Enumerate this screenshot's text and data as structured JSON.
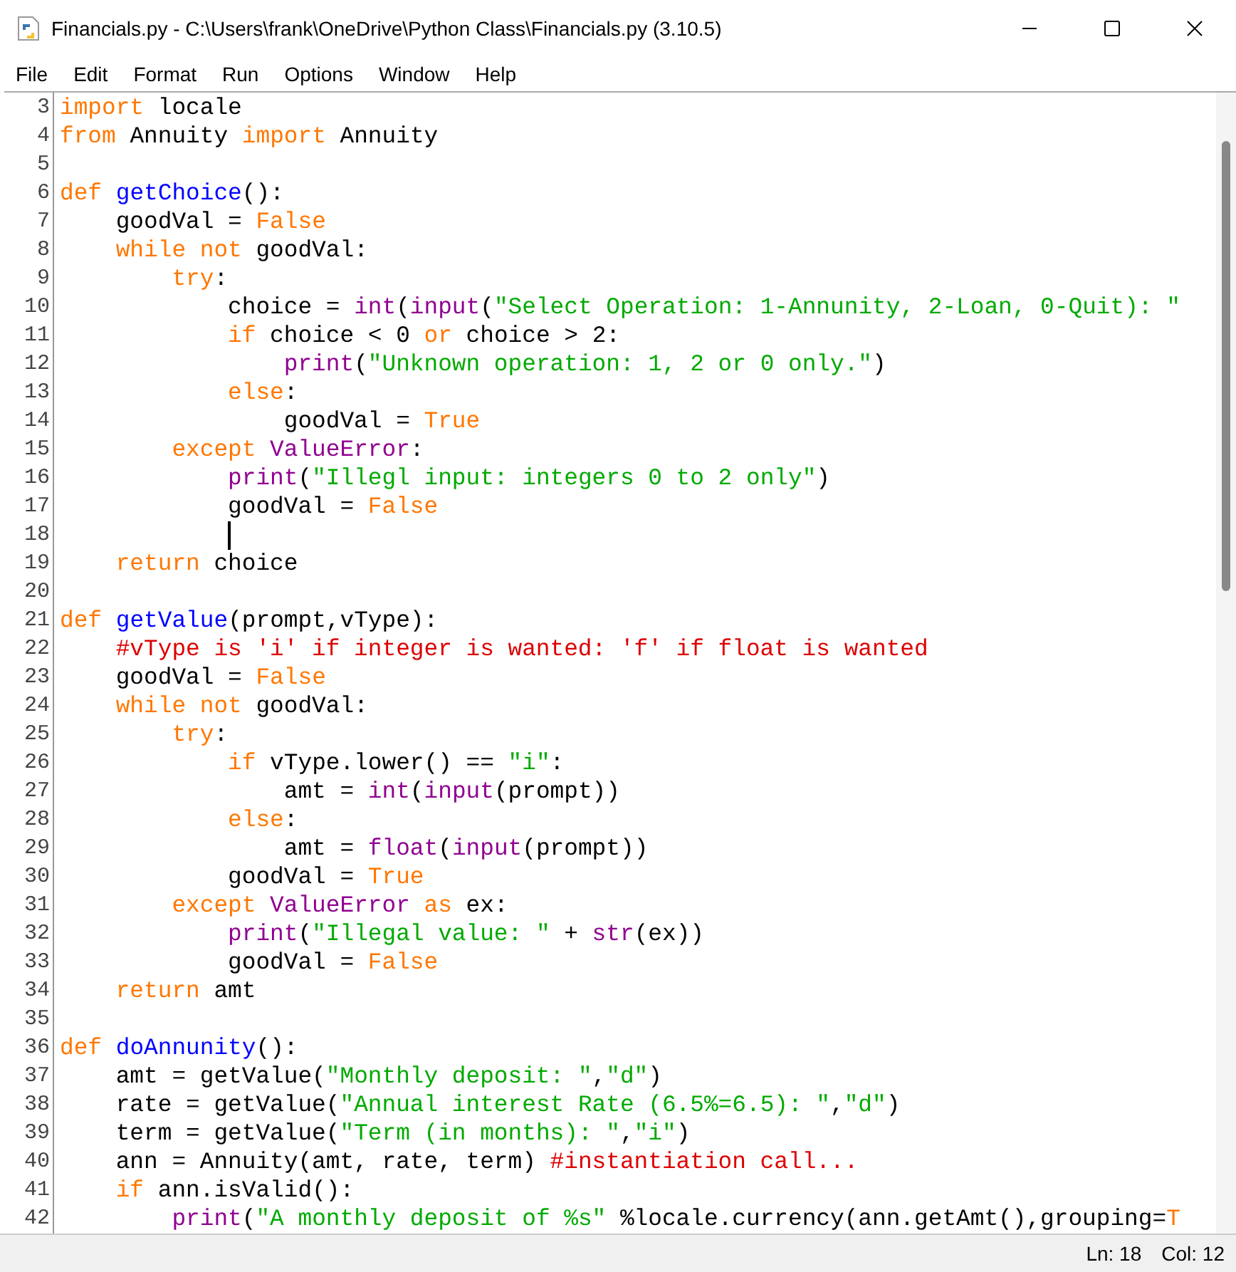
{
  "window": {
    "title": "Financials.py - C:\\Users\\frank\\OneDrive\\Python Class\\Financials.py (3.10.5)"
  },
  "menu": [
    {
      "label": "File"
    },
    {
      "label": "Edit"
    },
    {
      "label": "Format"
    },
    {
      "label": "Run"
    },
    {
      "label": "Options"
    },
    {
      "label": "Window"
    },
    {
      "label": "Help"
    }
  ],
  "editor": {
    "lines": [
      {
        "number": "3",
        "cursor": false,
        "tokens": [
          {
            "kind": "keyword",
            "text": "import"
          },
          {
            "kind": "plain",
            "text": " locale"
          }
        ]
      },
      {
        "number": "4",
        "cursor": false,
        "tokens": [
          {
            "kind": "keyword",
            "text": "from"
          },
          {
            "kind": "plain",
            "text": " Annuity "
          },
          {
            "kind": "keyword",
            "text": "import"
          },
          {
            "kind": "plain",
            "text": " Annuity"
          }
        ]
      },
      {
        "number": "5",
        "cursor": false
      },
      {
        "number": "6",
        "cursor": false,
        "tokens": [
          {
            "kind": "keyword",
            "text": "def "
          },
          {
            "kind": "definition",
            "text": "getChoice"
          },
          {
            "kind": "plain",
            "text": "():"
          }
        ],
        "children": [
          {
            "number": "7",
            "cursor": false,
            "tokens": [
              {
                "kind": "plain",
                "text": "goodVal = "
              },
              {
                "kind": "keyword",
                "text": "False"
              }
            ]
          },
          {
            "number": "8",
            "cursor": false,
            "tokens": [
              {
                "kind": "keyword",
                "text": "while not"
              },
              {
                "kind": "plain",
                "text": " goodVal:"
              }
            ],
            "children": [
              {
                "number": "9",
                "cursor": false,
                "tokens": [
                  {
                    "kind": "keyword",
                    "text": "try"
                  },
                  {
                    "kind": "plain",
                    "text": ":"
                  }
                ],
                "children": [
                  {
                    "number": "10",
                    "cursor": false,
                    "tokens": [
                      {
                        "kind": "plain",
                        "text": "choice = "
                      },
                      {
                        "kind": "builtin",
                        "text": "int"
                      },
                      {
                        "kind": "plain",
                        "text": "("
                      },
                      {
                        "kind": "builtin",
                        "text": "input"
                      },
                      {
                        "kind": "plain",
                        "text": "("
                      },
                      {
                        "kind": "string",
                        "text": "\"Select Operation: 1-Annunity, 2-Loan, 0-Quit): \""
                      }
                    ]
                  },
                  {
                    "number": "11",
                    "cursor": false,
                    "tokens": [
                      {
                        "kind": "keyword",
                        "text": "if"
                      },
                      {
                        "kind": "plain",
                        "text": " choice < 0 "
                      },
                      {
                        "kind": "keyword",
                        "text": "or"
                      },
                      {
                        "kind": "plain",
                        "text": " choice > 2:"
                      }
                    ],
                    "children": [
                      {
                        "number": "12",
                        "cursor": false,
                        "tokens": [
                          {
                            "kind": "builtin",
                            "text": "print"
                          },
                          {
                            "kind": "plain",
                            "text": "("
                          },
                          {
                            "kind": "string",
                            "text": "\"Unknown operation: 1, 2 or 0 only.\""
                          },
                          {
                            "kind": "plain",
                            "text": ")"
                          }
                        ]
                      }
                    ]
                  },
                  {
                    "number": "13",
                    "cursor": false,
                    "tokens": [
                      {
                        "kind": "keyword",
                        "text": "else"
                      },
                      {
                        "kind": "plain",
                        "text": ":"
                      }
                    ],
                    "children": [
                      {
                        "number": "14",
                        "cursor": false,
                        "tokens": [
                          {
                            "kind": "plain",
                            "text": "goodVal = "
                          },
                          {
                            "kind": "keyword",
                            "text": "True"
                          }
                        ]
                      }
                    ]
                  }
                ]
              },
              {
                "number": "15",
                "cursor": false,
                "tokens": [
                  {
                    "kind": "keyword",
                    "text": "except "
                  },
                  {
                    "kind": "builtin",
                    "text": "ValueError"
                  },
                  {
                    "kind": "plain",
                    "text": ":"
                  }
                ],
                "children": [
                  {
                    "number": "16",
                    "cursor": false,
                    "tokens": [
                      {
                        "kind": "builtin",
                        "text": "print"
                      },
                      {
                        "kind": "plain",
                        "text": "("
                      },
                      {
                        "kind": "string",
                        "text": "\"Illegl input: integers 0 to 2 only\""
                      },
                      {
                        "kind": "plain",
                        "text": ")"
                      }
                    ]
                  },
                  {
                    "number": "17",
                    "cursor": false,
                    "tokens": [
                      {
                        "kind": "plain",
                        "text": "goodVal = "
                      },
                      {
                        "kind": "keyword",
                        "text": "False"
                      }
                    ]
                  },
                  {
                    "number": "18",
                    "cursor": true
                  }
                ]
              }
            ]
          },
          {
            "number": "19",
            "cursor": false,
            "tokens": [
              {
                "kind": "keyword",
                "text": "return"
              },
              {
                "kind": "plain",
                "text": " choice"
              }
            ]
          }
        ]
      },
      {
        "number": "20",
        "cursor": false
      },
      {
        "number": "21",
        "cursor": false,
        "tokens": [
          {
            "kind": "keyword",
            "text": "def "
          },
          {
            "kind": "definition",
            "text": "getValue"
          },
          {
            "kind": "plain",
            "text": "(prompt,vType):"
          }
        ],
        "children": [
          {
            "number": "22",
            "cursor": false,
            "tokens": [
              {
                "kind": "comment",
                "text": "#vType is 'i' if integer is wanted: 'f' if float is wanted"
              }
            ]
          },
          {
            "number": "23",
            "cursor": false,
            "tokens": [
              {
                "kind": "plain",
                "text": "goodVal = "
              },
              {
                "kind": "keyword",
                "text": "False"
              }
            ]
          },
          {
            "number": "24",
            "cursor": false,
            "tokens": [
              {
                "kind": "keyword",
                "text": "while not"
              },
              {
                "kind": "plain",
                "text": " goodVal:"
              }
            ],
            "children": [
              {
                "number": "25",
                "cursor": false,
                "tokens": [
                  {
                    "kind": "keyword",
                    "text": "try"
                  },
                  {
                    "kind": "plain",
                    "text": ":"
                  }
                ],
                "children": [
                  {
                    "number": "26",
                    "cursor": false,
                    "tokens": [
                      {
                        "kind": "keyword",
                        "text": "if"
                      },
                      {
                        "kind": "plain",
                        "text": " vType.lower() == "
                      },
                      {
                        "kind": "string",
                        "text": "\"i\""
                      },
                      {
                        "kind": "plain",
                        "text": ":"
                      }
                    ],
                    "children": [
                      {
                        "number": "27",
                        "cursor": false,
                        "tokens": [
                          {
                            "kind": "plain",
                            "text": "amt = "
                          },
                          {
                            "kind": "builtin",
                            "text": "int"
                          },
                          {
                            "kind": "plain",
                            "text": "("
                          },
                          {
                            "kind": "builtin",
                            "text": "input"
                          },
                          {
                            "kind": "plain",
                            "text": "(prompt))"
                          }
                        ]
                      }
                    ]
                  },
                  {
                    "number": "28",
                    "cursor": false,
                    "tokens": [
                      {
                        "kind": "keyword",
                        "text": "else"
                      },
                      {
                        "kind": "plain",
                        "text": ":"
                      }
                    ],
                    "children": [
                      {
                        "number": "29",
                        "cursor": false,
                        "tokens": [
                          {
                            "kind": "plain",
                            "text": "amt = "
                          },
                          {
                            "kind": "builtin",
                            "text": "float"
                          },
                          {
                            "kind": "plain",
                            "text": "("
                          },
                          {
                            "kind": "builtin",
                            "text": "input"
                          },
                          {
                            "kind": "plain",
                            "text": "(prompt))"
                          }
                        ]
                      }
                    ]
                  },
                  {
                    "number": "30",
                    "cursor": false,
                    "tokens": [
                      {
                        "kind": "plain",
                        "text": "goodVal = "
                      },
                      {
                        "kind": "keyword",
                        "text": "True"
                      }
                    ]
                  }
                ]
              },
              {
                "number": "31",
                "cursor": false,
                "tokens": [
                  {
                    "kind": "keyword",
                    "text": "except "
                  },
                  {
                    "kind": "builtin",
                    "text": "ValueError"
                  },
                  {
                    "kind": "keyword",
                    "text": " as"
                  },
                  {
                    "kind": "plain",
                    "text": " ex:"
                  }
                ],
                "children": [
                  {
                    "number": "32",
                    "cursor": false,
                    "tokens": [
                      {
                        "kind": "builtin",
                        "text": "print"
                      },
                      {
                        "kind": "plain",
                        "text": "("
                      },
                      {
                        "kind": "string",
                        "text": "\"Illegal value: \""
                      },
                      {
                        "kind": "plain",
                        "text": " + "
                      },
                      {
                        "kind": "builtin",
                        "text": "str"
                      },
                      {
                        "kind": "plain",
                        "text": "(ex))"
                      }
                    ]
                  },
                  {
                    "number": "33",
                    "cursor": false,
                    "tokens": [
                      {
                        "kind": "plain",
                        "text": "goodVal = "
                      },
                      {
                        "kind": "keyword",
                        "text": "False"
                      }
                    ]
                  }
                ]
              }
            ]
          },
          {
            "number": "34",
            "cursor": false,
            "tokens": [
              {
                "kind": "keyword",
                "text": "return"
              },
              {
                "kind": "plain",
                "text": " amt"
              }
            ]
          }
        ]
      },
      {
        "number": "35",
        "cursor": false
      },
      {
        "number": "36",
        "cursor": false,
        "tokens": [
          {
            "kind": "keyword",
            "text": "def "
          },
          {
            "kind": "definition",
            "text": "doAnnunity"
          },
          {
            "kind": "plain",
            "text": "():"
          }
        ],
        "children": [
          {
            "number": "37",
            "cursor": false,
            "tokens": [
              {
                "kind": "plain",
                "text": "amt = getValue("
              },
              {
                "kind": "string",
                "text": "\"Monthly deposit: \""
              },
              {
                "kind": "plain",
                "text": ","
              },
              {
                "kind": "string",
                "text": "\"d\""
              },
              {
                "kind": "plain",
                "text": ")"
              }
            ]
          },
          {
            "number": "38",
            "cursor": false,
            "tokens": [
              {
                "kind": "plain",
                "text": "rate = getValue("
              },
              {
                "kind": "string",
                "text": "\"Annual interest Rate (6.5%=6.5): \""
              },
              {
                "kind": "plain",
                "text": ","
              },
              {
                "kind": "string",
                "text": "\"d\""
              },
              {
                "kind": "plain",
                "text": ")"
              }
            ]
          },
          {
            "number": "39",
            "cursor": false,
            "tokens": [
              {
                "kind": "plain",
                "text": "term = getValue("
              },
              {
                "kind": "string",
                "text": "\"Term (in months): \""
              },
              {
                "kind": "plain",
                "text": ","
              },
              {
                "kind": "string",
                "text": "\"i\""
              },
              {
                "kind": "plain",
                "text": ")"
              }
            ]
          },
          {
            "number": "40",
            "cursor": false,
            "tokens": [
              {
                "kind": "plain",
                "text": "ann = Annuity(amt, rate, term) "
              },
              {
                "kind": "comment",
                "text": "#instantiation call..."
              }
            ]
          },
          {
            "number": "41",
            "cursor": false,
            "tokens": [
              {
                "kind": "keyword",
                "text": "if"
              },
              {
                "kind": "plain",
                "text": " ann.isValid():"
              }
            ],
            "children": [
              {
                "number": "42",
                "cursor": false,
                "tokens": [
                  {
                    "kind": "builtin",
                    "text": "print"
                  },
                  {
                    "kind": "plain",
                    "text": "("
                  },
                  {
                    "kind": "string",
                    "text": "\"A monthly deposit of %s\""
                  },
                  {
                    "kind": "plain",
                    "text": " %locale.currency(ann.getAmt(),grouping="
                  },
                  {
                    "kind": "keyword",
                    "text": "T"
                  }
                ]
              }
            ]
          }
        ]
      }
    ]
  },
  "status_bar": {
    "line": "Ln: 18",
    "column": "Col: 12"
  }
}
